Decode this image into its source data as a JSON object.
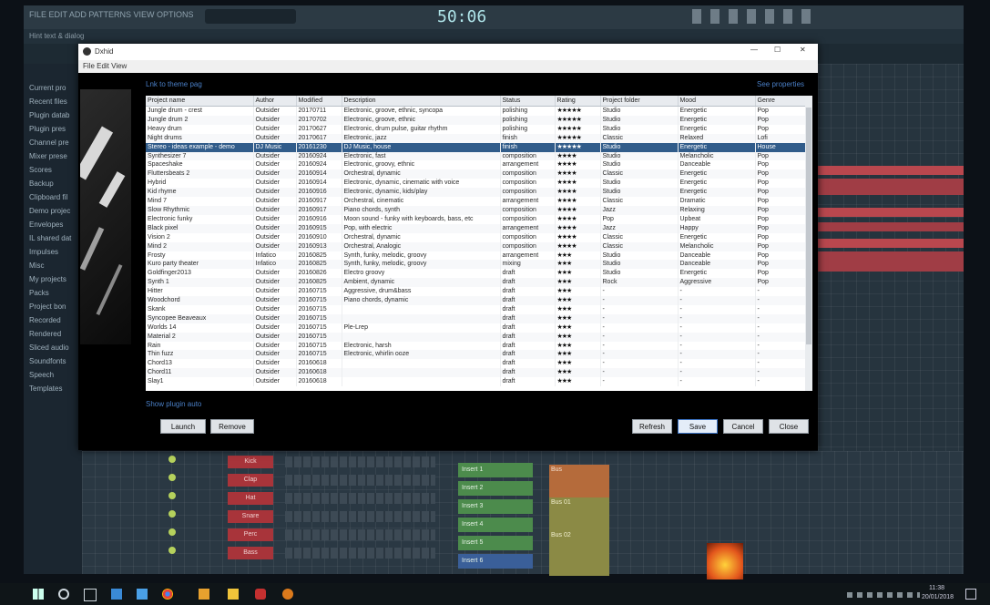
{
  "fl": {
    "title_bar": "FILE  EDIT  ADD  PATTERNS  VIEW  OPTIONS  TOOLS  HELP",
    "hint": "Hint text & dialog",
    "time": "50:06",
    "browser_items": [
      "Current pro",
      "Recent files",
      "Plugin datab",
      "Plugin pres",
      "Channel pre",
      "Mixer prese",
      "Scores",
      "Backup",
      "Clipboard fil",
      "Demo projec",
      "Envelopes",
      "IL shared dat",
      "Impulses",
      "Misc",
      "My projects",
      "Packs",
      "Project bon",
      "Recorded",
      "Rendered",
      "Sliced audio",
      "Soundfonts",
      "Speech",
      "Templates"
    ],
    "channels": [
      "Kick",
      "Clap",
      "Hat",
      "Snare",
      "Perc",
      "Bass"
    ],
    "mixer_slots": [
      "Insert 1",
      "Insert 2",
      "Insert 3",
      "Insert 4",
      "Insert 5",
      "Insert 6"
    ],
    "playlist_clips": [
      "Bus",
      "Bus 01",
      "Bus 02"
    ]
  },
  "dialog": {
    "title": "Dxhid",
    "menu": "File  Edit  View",
    "top_left_link": "Lnk to theme pag",
    "top_right_link": "See properties",
    "bottom_link": "Show plugin auto",
    "columns": [
      "Project name",
      "Author",
      "Modified",
      "Description",
      "Status",
      "Rating",
      "Project folder",
      "Mood",
      "Genre"
    ],
    "rows": [
      {
        "name": "Jungle drum - crest",
        "author": "Outsider",
        "modified": "20170711",
        "desc": "Electronic, groove, ethnic, syncopa",
        "status": "polishing",
        "rating": "★★★★★",
        "folder": "Studio",
        "mood": "Energetic",
        "genre": "Pop"
      },
      {
        "name": "Jungle drum 2",
        "author": "Outsider",
        "modified": "20170702",
        "desc": "Electronic, groove, ethnic",
        "status": "polishing",
        "rating": "★★★★★",
        "folder": "Studio",
        "mood": "Energetic",
        "genre": "Pop"
      },
      {
        "name": "Heavy drum",
        "author": "Outsider",
        "modified": "20170627",
        "desc": "Electronic, drum pulse, guitar rhythm",
        "status": "polishing",
        "rating": "★★★★★",
        "folder": "Studio",
        "mood": "Energetic",
        "genre": "Pop"
      },
      {
        "name": "Night drums",
        "author": "Outsider",
        "modified": "20170617",
        "desc": "Electronic, jazz",
        "status": "finish",
        "rating": "★★★★★",
        "folder": "Classic",
        "mood": "Relaxed",
        "genre": "Lofi"
      },
      {
        "name": "Stereo - ideas example - demo",
        "author": "DJ Music",
        "modified": "20161230",
        "desc": "DJ Music, house",
        "status": "finish",
        "rating": "★★★★★",
        "folder": "Studio",
        "mood": "Energetic",
        "genre": "House"
      },
      {
        "name": "Synthesizer 7",
        "author": "Outsider",
        "modified": "20160924",
        "desc": "Electronic, fast",
        "status": "composition",
        "rating": "★★★★",
        "folder": "Studio",
        "mood": "Melancholic",
        "genre": "Pop"
      },
      {
        "name": "Spaceshake",
        "author": "Outsider",
        "modified": "20160924",
        "desc": "Electronic, groovy, ethnic",
        "status": "arrangement",
        "rating": "★★★★",
        "folder": "Studio",
        "mood": "Danceable",
        "genre": "Pop"
      },
      {
        "name": "Fluttersbeats 2",
        "author": "Outsider",
        "modified": "20160914",
        "desc": "Orchestral, dynamic",
        "status": "composition",
        "rating": "★★★★",
        "folder": "Classic",
        "mood": "Energetic",
        "genre": "Pop"
      },
      {
        "name": "Hybrid",
        "author": "Outsider",
        "modified": "20160914",
        "desc": "Electronic, dynamic, cinematic with voice",
        "status": "composition",
        "rating": "★★★★",
        "folder": "Studio",
        "mood": "Energetic",
        "genre": "Pop"
      },
      {
        "name": "Kid rhyme",
        "author": "Outsider",
        "modified": "20160916",
        "desc": "Electronic, dynamic, kids/play",
        "status": "composition",
        "rating": "★★★★",
        "folder": "Studio",
        "mood": "Energetic",
        "genre": "Pop"
      },
      {
        "name": "Mind 7",
        "author": "Outsider",
        "modified": "20160917",
        "desc": "Orchestral, cinematic",
        "status": "arrangement",
        "rating": "★★★★",
        "folder": "Classic",
        "mood": "Dramatic",
        "genre": "Pop"
      },
      {
        "name": "Slow Rhythmic",
        "author": "Outsider",
        "modified": "20160917",
        "desc": "Piano chords, synth",
        "status": "composition",
        "rating": "★★★★",
        "folder": "Jazz",
        "mood": "Relaxing",
        "genre": "Pop"
      },
      {
        "name": "Electronic funky",
        "author": "Outsider",
        "modified": "20160916",
        "desc": "Moon sound - funky with keyboards, bass, etc",
        "status": "composition",
        "rating": "★★★★",
        "folder": "Pop",
        "mood": "Upbeat",
        "genre": "Pop"
      },
      {
        "name": "Black pixel",
        "author": "Outsider",
        "modified": "20160915",
        "desc": "Pop, with electric",
        "status": "arrangement",
        "rating": "★★★★",
        "folder": "Jazz",
        "mood": "Happy",
        "genre": "Pop"
      },
      {
        "name": "Vision 2",
        "author": "Outsider",
        "modified": "20160910",
        "desc": "Orchestral, dynamic",
        "status": "composition",
        "rating": "★★★★",
        "folder": "Classic",
        "mood": "Energetic",
        "genre": "Pop"
      },
      {
        "name": "Mind 2",
        "author": "Outsider",
        "modified": "20160913",
        "desc": "Orchestral, Analogic",
        "status": "composition",
        "rating": "★★★★",
        "folder": "Classic",
        "mood": "Melancholic",
        "genre": "Pop"
      },
      {
        "name": "Frosty",
        "author": "Infatico",
        "modified": "20160825",
        "desc": "Synth, funky, melodic, groovy",
        "status": "arrangement",
        "rating": "★★★",
        "folder": "Studio",
        "mood": "Danceable",
        "genre": "Pop"
      },
      {
        "name": "Kuro party theater",
        "author": "Infatico",
        "modified": "20160825",
        "desc": "Synth, funky, melodic, groovy",
        "status": "mixing",
        "rating": "★★★",
        "folder": "Studio",
        "mood": "Danceable",
        "genre": "Pop"
      },
      {
        "name": "Goldfinger2013",
        "author": "Outsider",
        "modified": "20160826",
        "desc": "Electro groovy",
        "status": "draft",
        "rating": "★★★",
        "folder": "Studio",
        "mood": "Energetic",
        "genre": "Pop"
      },
      {
        "name": "Synth 1",
        "author": "Outsider",
        "modified": "20160825",
        "desc": "Ambient, dynamic",
        "status": "draft",
        "rating": "★★★",
        "folder": "Rock",
        "mood": "Aggressive",
        "genre": "Pop"
      },
      {
        "name": "Hitter",
        "author": "Outsider",
        "modified": "20160715",
        "desc": "Aggressive, drum&bass",
        "status": "draft",
        "rating": "★★★",
        "folder": "-",
        "mood": "-",
        "genre": "-"
      },
      {
        "name": "Woodchord",
        "author": "Outsider",
        "modified": "20160715",
        "desc": "Piano chords, dynamic",
        "status": "draft",
        "rating": "★★★",
        "folder": "-",
        "mood": "-",
        "genre": "-"
      },
      {
        "name": "Skank",
        "author": "Outsider",
        "modified": "20160715",
        "desc": "",
        "status": "draft",
        "rating": "★★★",
        "folder": "-",
        "mood": "-",
        "genre": "-"
      },
      {
        "name": "Syncopee Beaveaux",
        "author": "Outsider",
        "modified": "20160715",
        "desc": "",
        "status": "draft",
        "rating": "★★★",
        "folder": "-",
        "mood": "-",
        "genre": "-"
      },
      {
        "name": "Worlds 14",
        "author": "Outsider",
        "modified": "20160715",
        "desc": "Ple-Lrep",
        "status": "draft",
        "rating": "★★★",
        "folder": "-",
        "mood": "-",
        "genre": "-"
      },
      {
        "name": "Material 2",
        "author": "Outsider",
        "modified": "20160715",
        "desc": "",
        "status": "draft",
        "rating": "★★★",
        "folder": "-",
        "mood": "-",
        "genre": "-"
      },
      {
        "name": "Rain",
        "author": "Outsider",
        "modified": "20160715",
        "desc": "Electronic, harsh",
        "status": "draft",
        "rating": "★★★",
        "folder": "-",
        "mood": "-",
        "genre": "-"
      },
      {
        "name": "Thin fuzz",
        "author": "Outsider",
        "modified": "20160715",
        "desc": "Electronic, whirlin ooze",
        "status": "draft",
        "rating": "★★★",
        "folder": "-",
        "mood": "-",
        "genre": "-"
      },
      {
        "name": "Chord13",
        "author": "Outsider",
        "modified": "20160618",
        "desc": "",
        "status": "draft",
        "rating": "★★★",
        "folder": "-",
        "mood": "-",
        "genre": "-"
      },
      {
        "name": "Chord11",
        "author": "Outsider",
        "modified": "20160618",
        "desc": "",
        "status": "draft",
        "rating": "★★★",
        "folder": "-",
        "mood": "-",
        "genre": "-"
      },
      {
        "name": "Slay1",
        "author": "Outsider",
        "modified": "20160618",
        "desc": "",
        "status": "draft",
        "rating": "★★★",
        "folder": "-",
        "mood": "-",
        "genre": "-"
      }
    ],
    "selected_index": 4,
    "buttons": {
      "left1": "Launch",
      "left2": "Remove",
      "refresh": "Refresh",
      "save": "Save",
      "cancel": "Cancel",
      "ok": "Close"
    }
  },
  "taskbar": {
    "time": "11:38",
    "date": "20/01/2018"
  },
  "colors": {
    "selected_row": "#315c8a",
    "link": "#4a7fc6",
    "channel_btn": "#a8343a",
    "mixer_slot": "#4c8b4c"
  }
}
